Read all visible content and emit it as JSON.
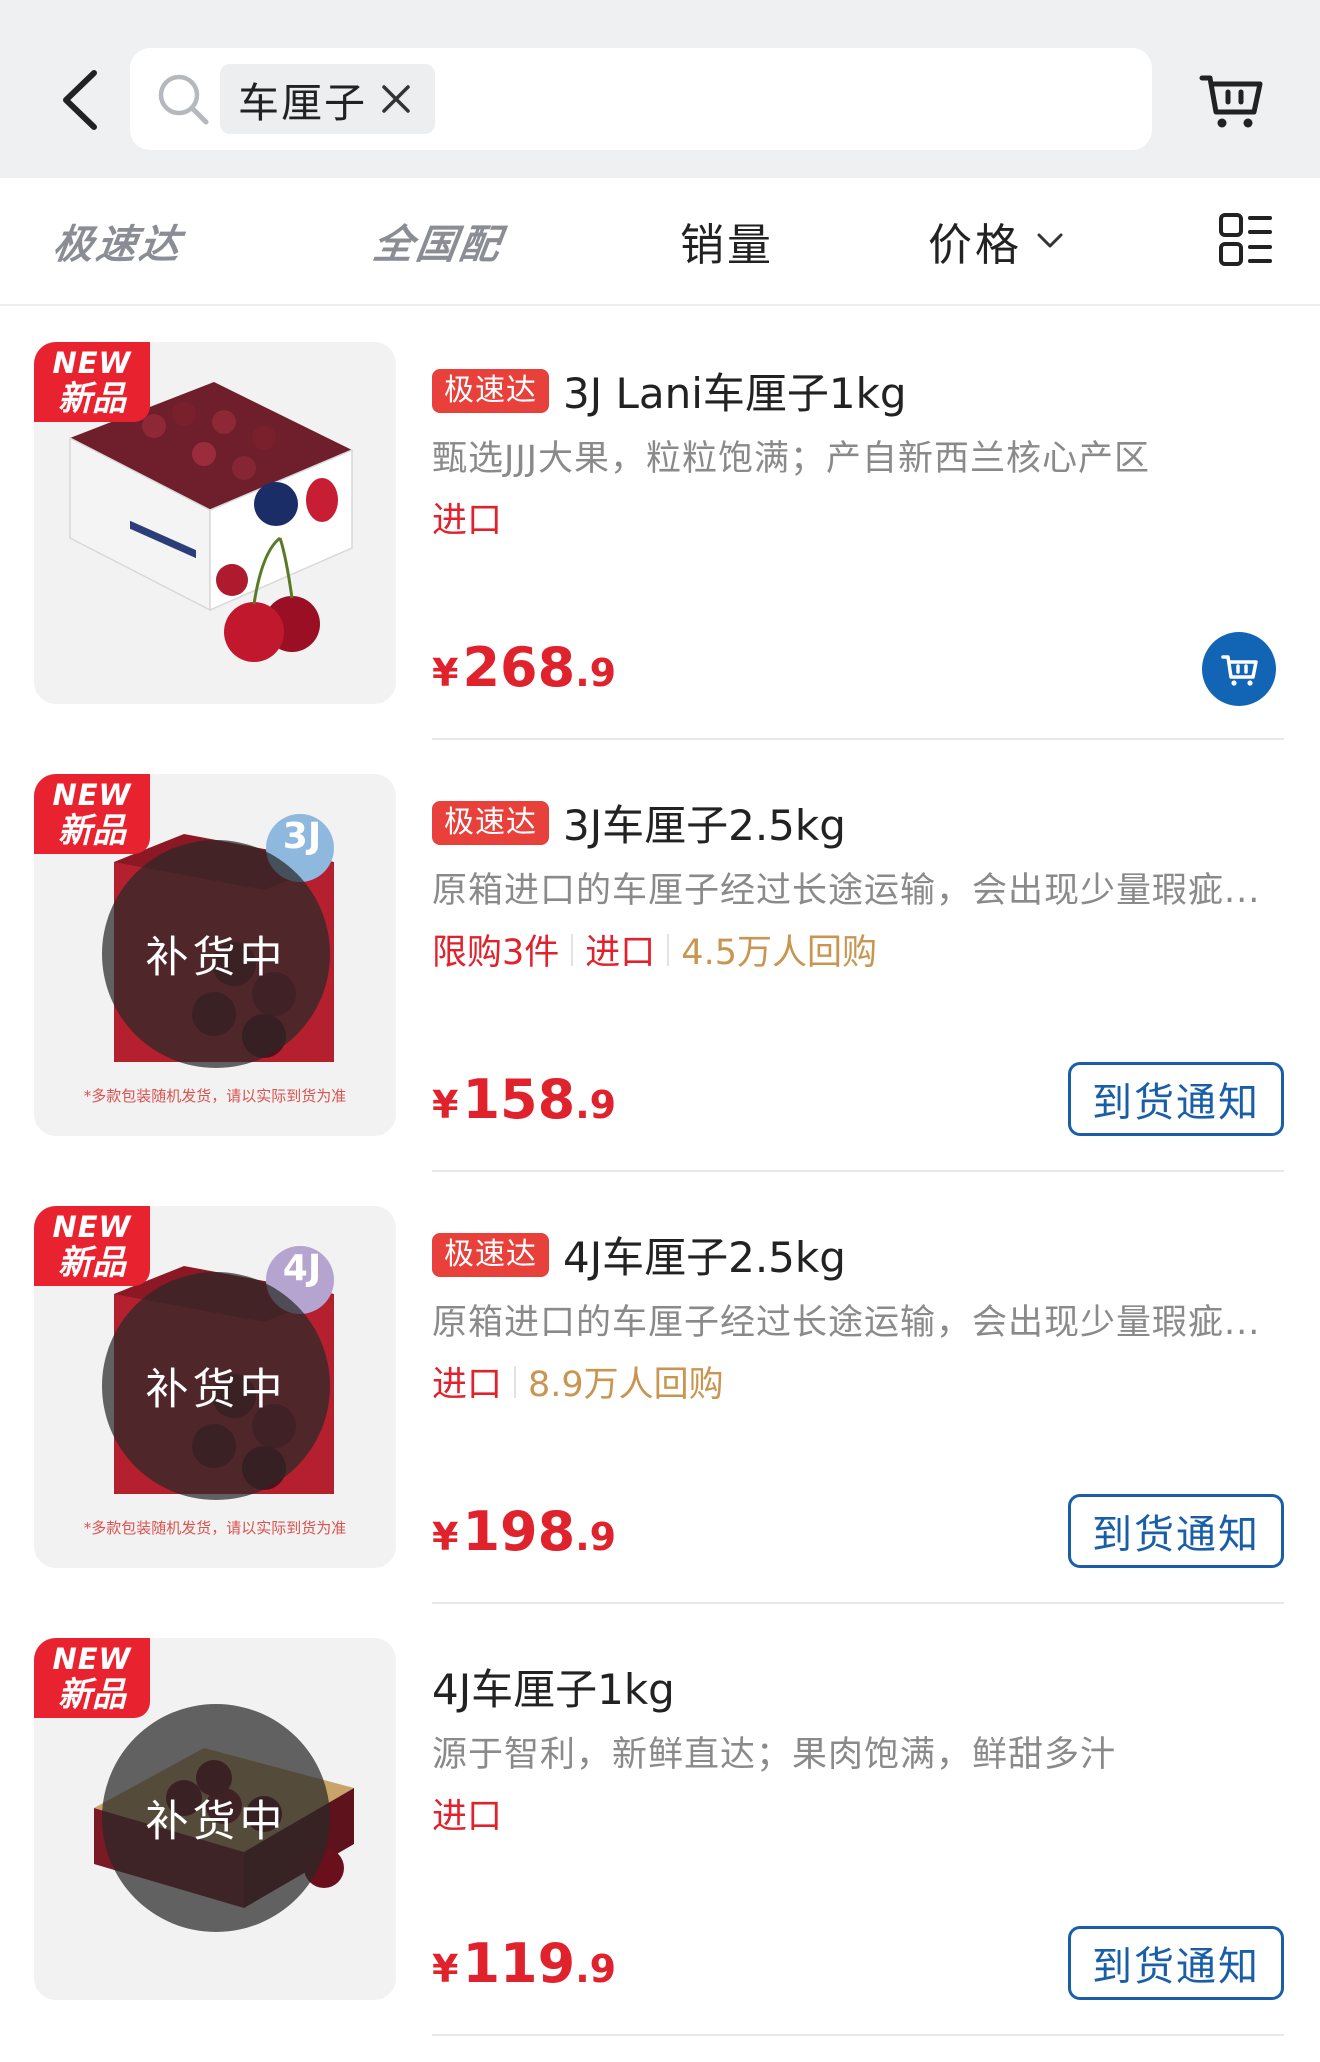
{
  "header": {
    "search": {
      "query_chip": "车厘子"
    }
  },
  "filters": {
    "tab_express": "极速达",
    "tab_nationwide": "全国配",
    "tab_sales": "销量",
    "tab_price": "价格"
  },
  "products": [
    {
      "badge_en": "NEW",
      "badge_zh": "新品",
      "fast_tag": "极速达",
      "title": "3J Lani车厘子1kg",
      "description": "甄选JJJ大果，粒粒饱满；产自新西兰核心产区",
      "tags": [
        "进口"
      ],
      "price_int": "268",
      "price_dec": ".9",
      "currency": "¥",
      "action": "add-to-cart"
    },
    {
      "badge_en": "NEW",
      "badge_zh": "新品",
      "fast_tag": "极速达",
      "title": "3J车厘子2.5kg",
      "description": "原箱进口的车厘子经过长途运输，会出现少量瑕疵...",
      "tags": [
        "限购3件",
        "进口",
        "4.5万人回购"
      ],
      "restock_overlay": "补货中",
      "image_caption": "*多款包装随机发货，请以实际到货为准",
      "size_badge": "3J",
      "price_int": "158",
      "price_dec": ".9",
      "currency": "¥",
      "notify_label": "到货通知"
    },
    {
      "badge_en": "NEW",
      "badge_zh": "新品",
      "fast_tag": "极速达",
      "title": "4J车厘子2.5kg",
      "description": "原箱进口的车厘子经过长途运输，会出现少量瑕疵...",
      "tags": [
        "进口",
        "8.9万人回购"
      ],
      "restock_overlay": "补货中",
      "image_caption": "*多款包装随机发货，请以实际到货为准",
      "size_badge": "4J",
      "price_int": "198",
      "price_dec": ".9",
      "currency": "¥",
      "notify_label": "到货通知"
    },
    {
      "badge_en": "NEW",
      "badge_zh": "新品",
      "title": "4J车厘子1kg",
      "description": "源于智利，新鲜直达；果肉饱满，鲜甜多汁",
      "tags": [
        "进口"
      ],
      "restock_overlay": "补货中",
      "price_int": "119",
      "price_dec": ".9",
      "currency": "¥",
      "notify_label": "到货通知"
    }
  ],
  "icons": {
    "back": "chevron-left-icon",
    "search": "search-icon",
    "clear": "close-icon",
    "cart": "cart-icon",
    "price_sort": "chevron-down-icon",
    "layout": "grid-list-icon",
    "add_cart": "cart-plus-icon"
  },
  "colors": {
    "price_red": "#e0222d",
    "brand_blue": "#1165b4",
    "repurchase_gold": "#c99652",
    "fast_tag_red": "#e8413b"
  }
}
